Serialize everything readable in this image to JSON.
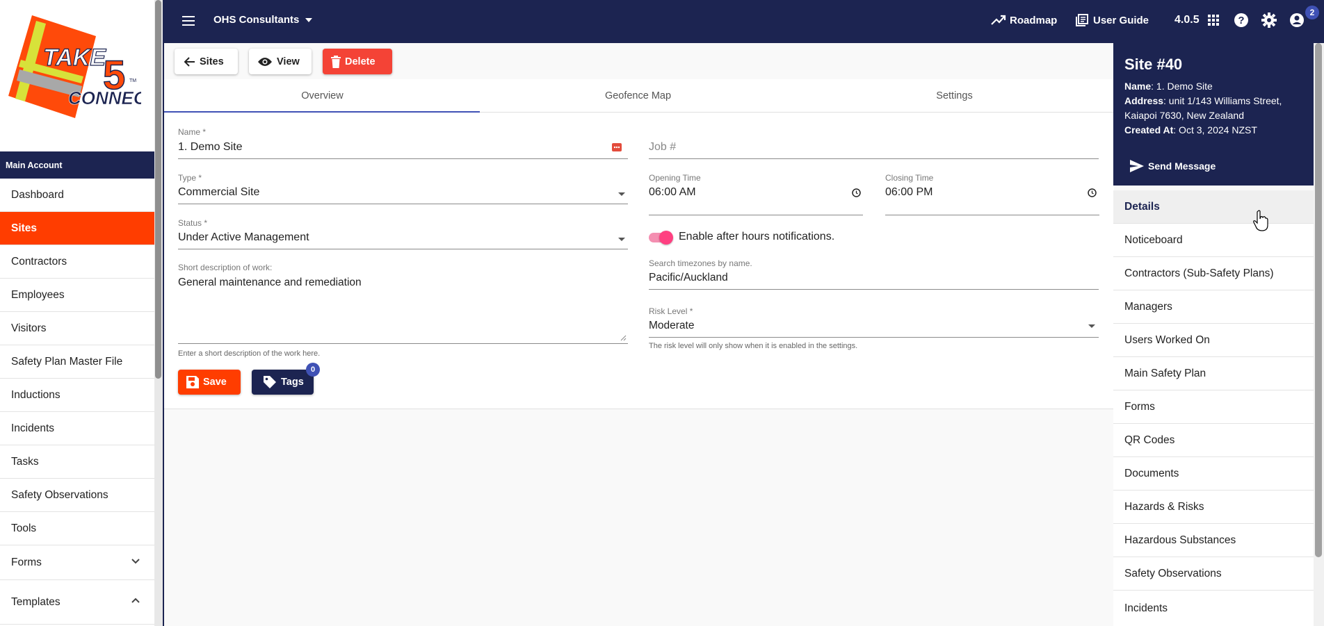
{
  "logo": {
    "line1": "TAKE",
    "digit": "5",
    "line2": "CONNECT",
    "tm": "TM"
  },
  "sidebar": {
    "account_label": "Main Account",
    "items": [
      {
        "label": "Dashboard"
      },
      {
        "label": "Sites",
        "active": true
      },
      {
        "label": "Contractors"
      },
      {
        "label": "Employees"
      },
      {
        "label": "Visitors"
      },
      {
        "label": "Safety Plan Master File"
      },
      {
        "label": "Inductions"
      },
      {
        "label": "Incidents"
      },
      {
        "label": "Tasks"
      },
      {
        "label": "Safety Observations"
      },
      {
        "label": "Tools"
      },
      {
        "label": "Forms",
        "expand": "chevron-down-icon"
      },
      {
        "label": "Templates",
        "expand": "chevron-up-icon"
      }
    ]
  },
  "topbar": {
    "org_name": "OHS Consultants",
    "roadmap": "Roadmap",
    "user_guide": "User Guide",
    "version": "4.0.5",
    "notifications": "2"
  },
  "actions": {
    "back": "Sites",
    "view": "View",
    "delete": "Delete"
  },
  "tabs": [
    {
      "label": "Overview",
      "active": true
    },
    {
      "label": "Geofence Map"
    },
    {
      "label": "Settings"
    }
  ],
  "form": {
    "name_label": "Name *",
    "name_value": "1. Demo Site",
    "job_placeholder": "Job #",
    "type_label": "Type *",
    "type_value": "Commercial Site",
    "opening_label": "Opening Time",
    "opening_value": "06:00  AM",
    "closing_label": "Closing Time",
    "closing_value": "06:00  PM",
    "status_label": "Status *",
    "status_value": "Under Active Management",
    "after_hours_label": "Enable after hours notifications.",
    "after_hours_enabled": true,
    "desc_label": "Short description of work:",
    "desc_value": "General maintenance and remediation",
    "desc_hint": "Enter a short description of the work here.",
    "tz_label": "Search timezones by name.",
    "tz_value": "Pacific/Auckland",
    "risk_label": "Risk Level *",
    "risk_value": "Moderate",
    "risk_hint": "The risk level will only show when it is enabled in the settings.",
    "save": "Save",
    "tags": "Tags",
    "tags_count": "0"
  },
  "site_panel": {
    "title": "Site #40",
    "name_key": "Name",
    "name_value": ": 1. Demo Site",
    "address_key": "Address",
    "address_value": ": unit 1/143 Williams Street, Kaiapoi 7630, New Zealand",
    "created_key": "Created At",
    "created_value": ": Oct 3, 2024 NZST",
    "send_message": "Send Message",
    "items": [
      {
        "label": "Details",
        "selected": true
      },
      {
        "label": "Noticeboard"
      },
      {
        "label": "Contractors (Sub-Safety Plans)"
      },
      {
        "label": "Managers"
      },
      {
        "label": "Users Worked On"
      },
      {
        "label": "Main Safety Plan"
      },
      {
        "label": "Forms"
      },
      {
        "label": "QR Codes"
      },
      {
        "label": "Documents"
      },
      {
        "label": "Hazards & Risks"
      },
      {
        "label": "Hazardous Substances"
      },
      {
        "label": "Safety Observations"
      },
      {
        "label": "Incidents"
      }
    ]
  },
  "colors": {
    "navy": "#1c2451",
    "orange": "#ff3d00",
    "red": "#f44336",
    "indigo": "#3f51b5",
    "toggle": "#ff4081"
  }
}
